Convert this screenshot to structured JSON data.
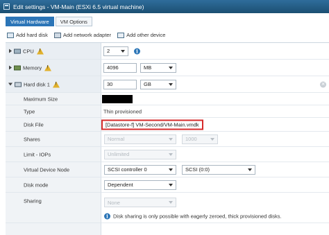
{
  "window": {
    "title": "Edit settings - VM-Main (ESXi 6.5 virtual machine)"
  },
  "tabs": [
    {
      "label": "Virtual Hardware",
      "active": true
    },
    {
      "label": "VM Options",
      "active": false
    }
  ],
  "toolbar": {
    "add_hard_disk": "Add hard disk",
    "add_network_adapter": "Add network adapter",
    "add_other_device": "Add other device"
  },
  "hardware": {
    "cpu": {
      "label": "CPU",
      "value": "2"
    },
    "memory": {
      "label": "Memory",
      "value": "4096",
      "unit": "MB"
    },
    "hard_disk": {
      "label": "Hard disk 1",
      "value": "30",
      "unit": "GB",
      "max_size_label": "Maximum Size",
      "type_label": "Type",
      "type_value": "Thin provisioned",
      "disk_file_label": "Disk File",
      "disk_file_value": "[Datastore-f] VM-Second/VM-Main.vmdk",
      "shares_label": "Shares",
      "shares_value": "Normal",
      "shares_amount": "1000",
      "limit_label": "Limit - IOPs",
      "limit_value": "Unlimited",
      "vdn_label": "Virtual Device Node",
      "controller_value": "SCSI controller 0",
      "scsi_value": "SCSI (0:0)",
      "mode_label": "Disk mode",
      "mode_value": "Dependent",
      "sharing_label": "Sharing",
      "sharing_value": "None",
      "sharing_note": "Disk sharing is only possible with eagerly zeroed, thick provisioned disks."
    }
  },
  "colors": {
    "accent": "#2b75b7",
    "highlight_border": "#d62b2b",
    "titlebar": "#1b4f72",
    "warning": "#e1b12c"
  }
}
